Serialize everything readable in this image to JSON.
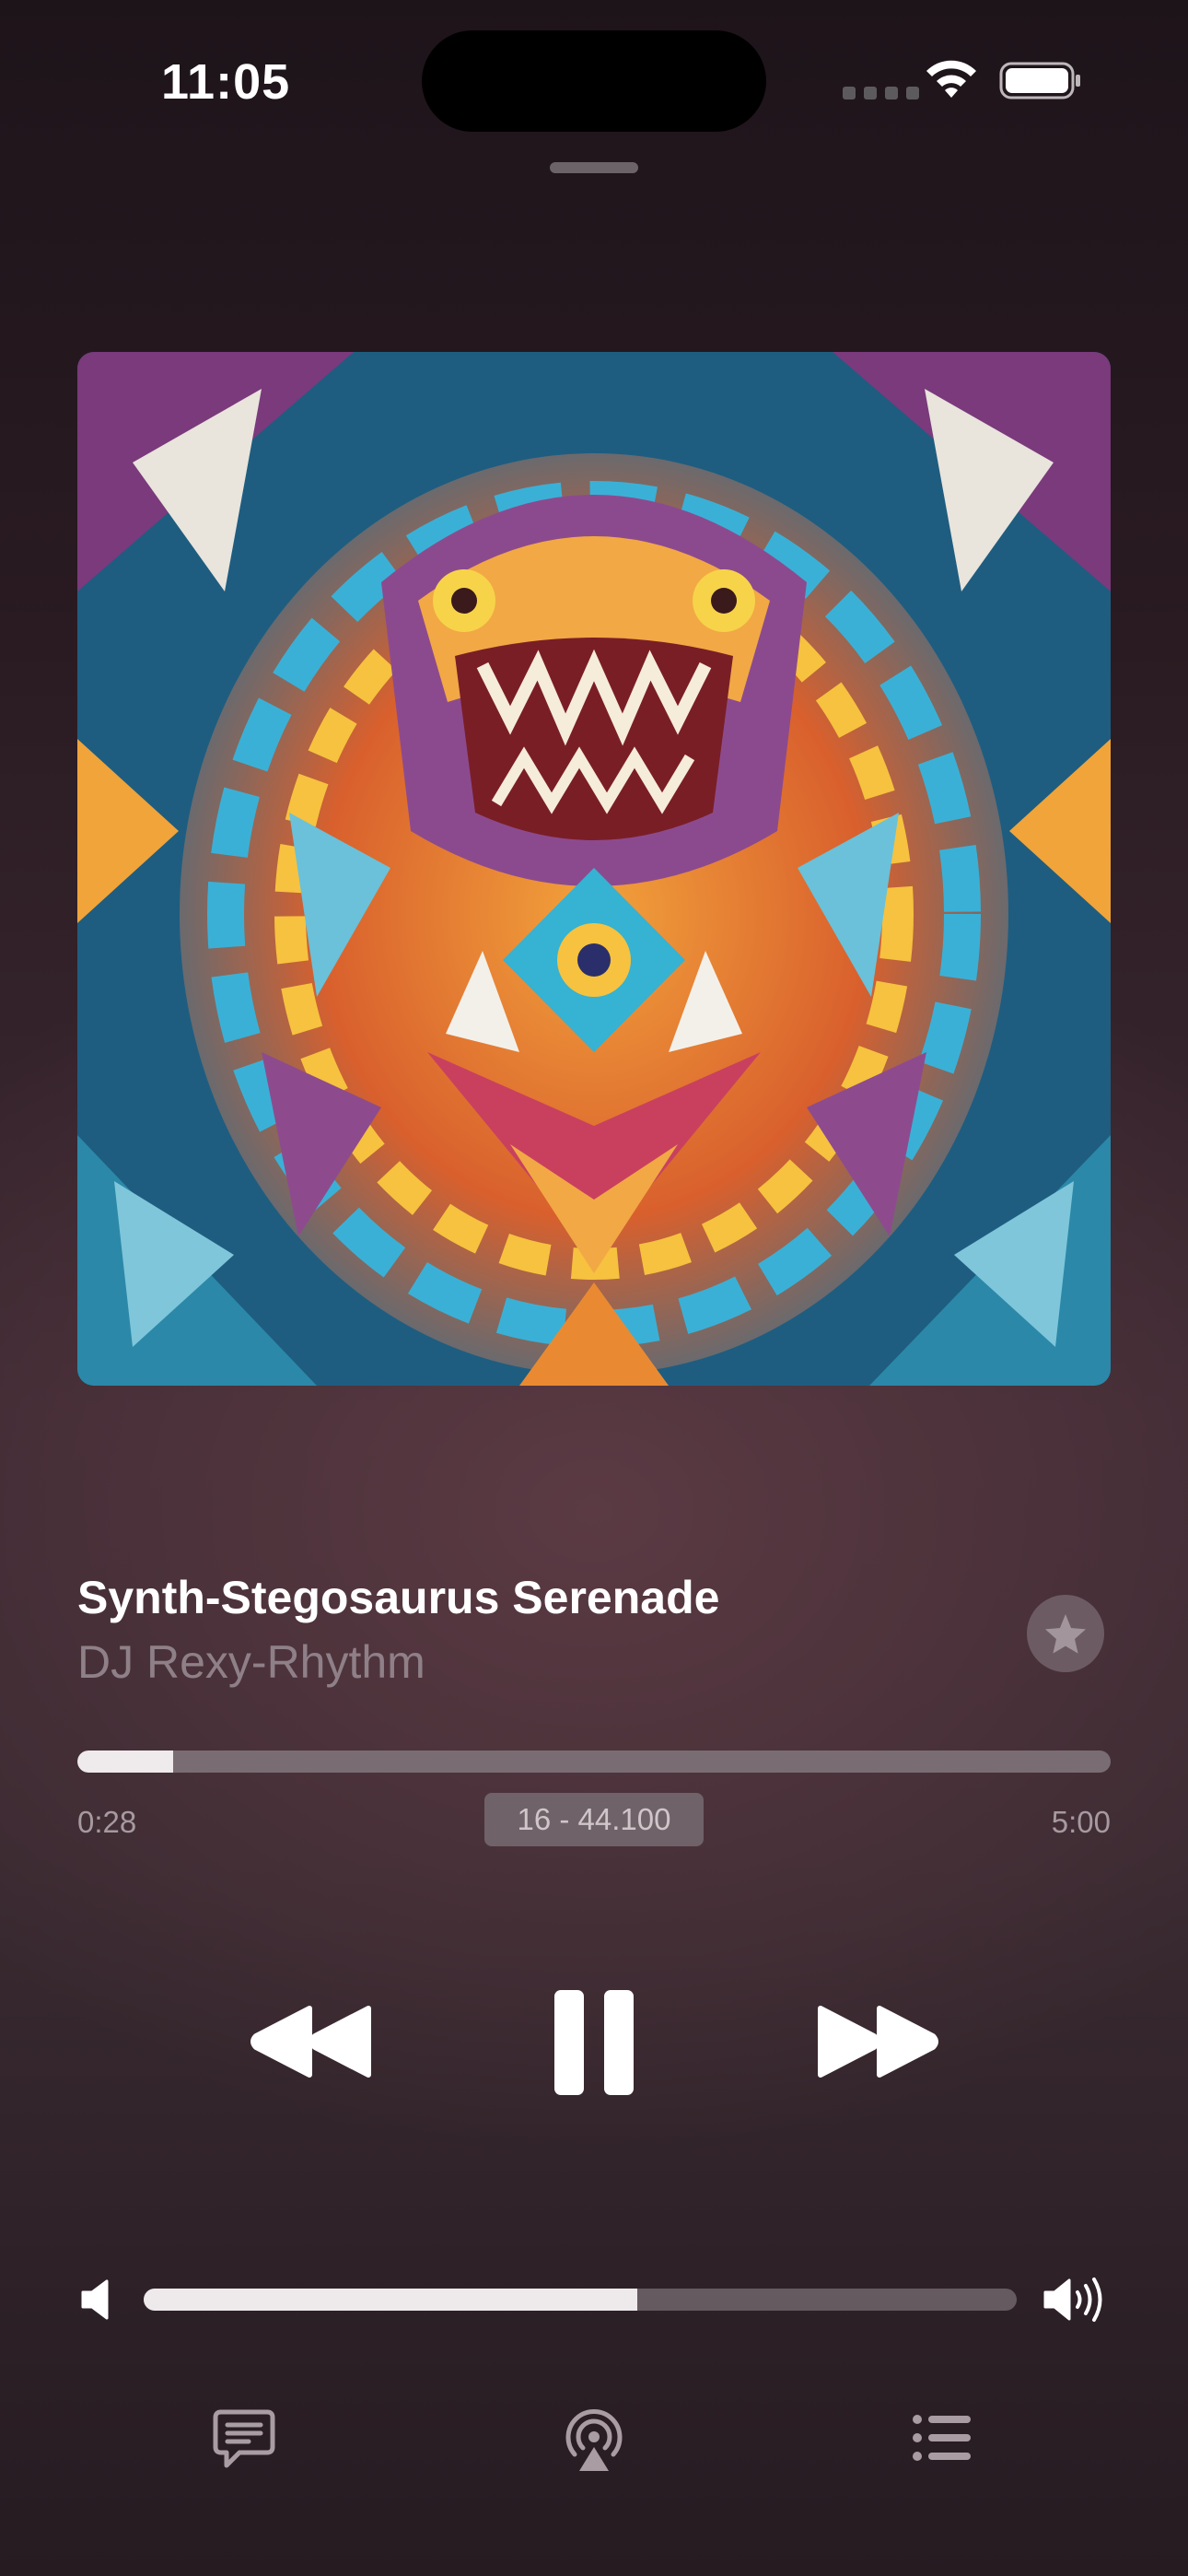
{
  "status_bar": {
    "time": "11:05",
    "signal_icon": "cellular-signal-icon",
    "wifi_icon": "wifi-icon",
    "battery_icon": "battery-icon"
  },
  "now_playing": {
    "artwork_icon": "album-artwork-mosaic-dinosaur",
    "title": "Synth-Stegosaurus Serenade",
    "artist": "DJ Rexy-Rhythm",
    "favorite_icon": "star-icon"
  },
  "playback": {
    "elapsed": "0:28",
    "duration": "5:00",
    "quality_badge": "16 - 44.100",
    "progress_fraction": 0.093
  },
  "controls": {
    "previous_icon": "rewind-icon",
    "pause_icon": "pause-icon",
    "next_icon": "fast-forward-icon"
  },
  "volume": {
    "level_fraction": 0.565,
    "low_icon": "speaker-low-icon",
    "high_icon": "speaker-high-icon"
  },
  "bottom_bar": {
    "lyrics_icon": "lyrics-bubble-icon",
    "airplay_icon": "airplay-audio-icon",
    "queue_icon": "queue-list-icon"
  },
  "colors": {
    "background_top": "#1d141a",
    "background_mid": "#5b3a43",
    "progress_fill": "#efeaec",
    "progress_track": "#796d73",
    "secondary_text": "#8f8088"
  }
}
